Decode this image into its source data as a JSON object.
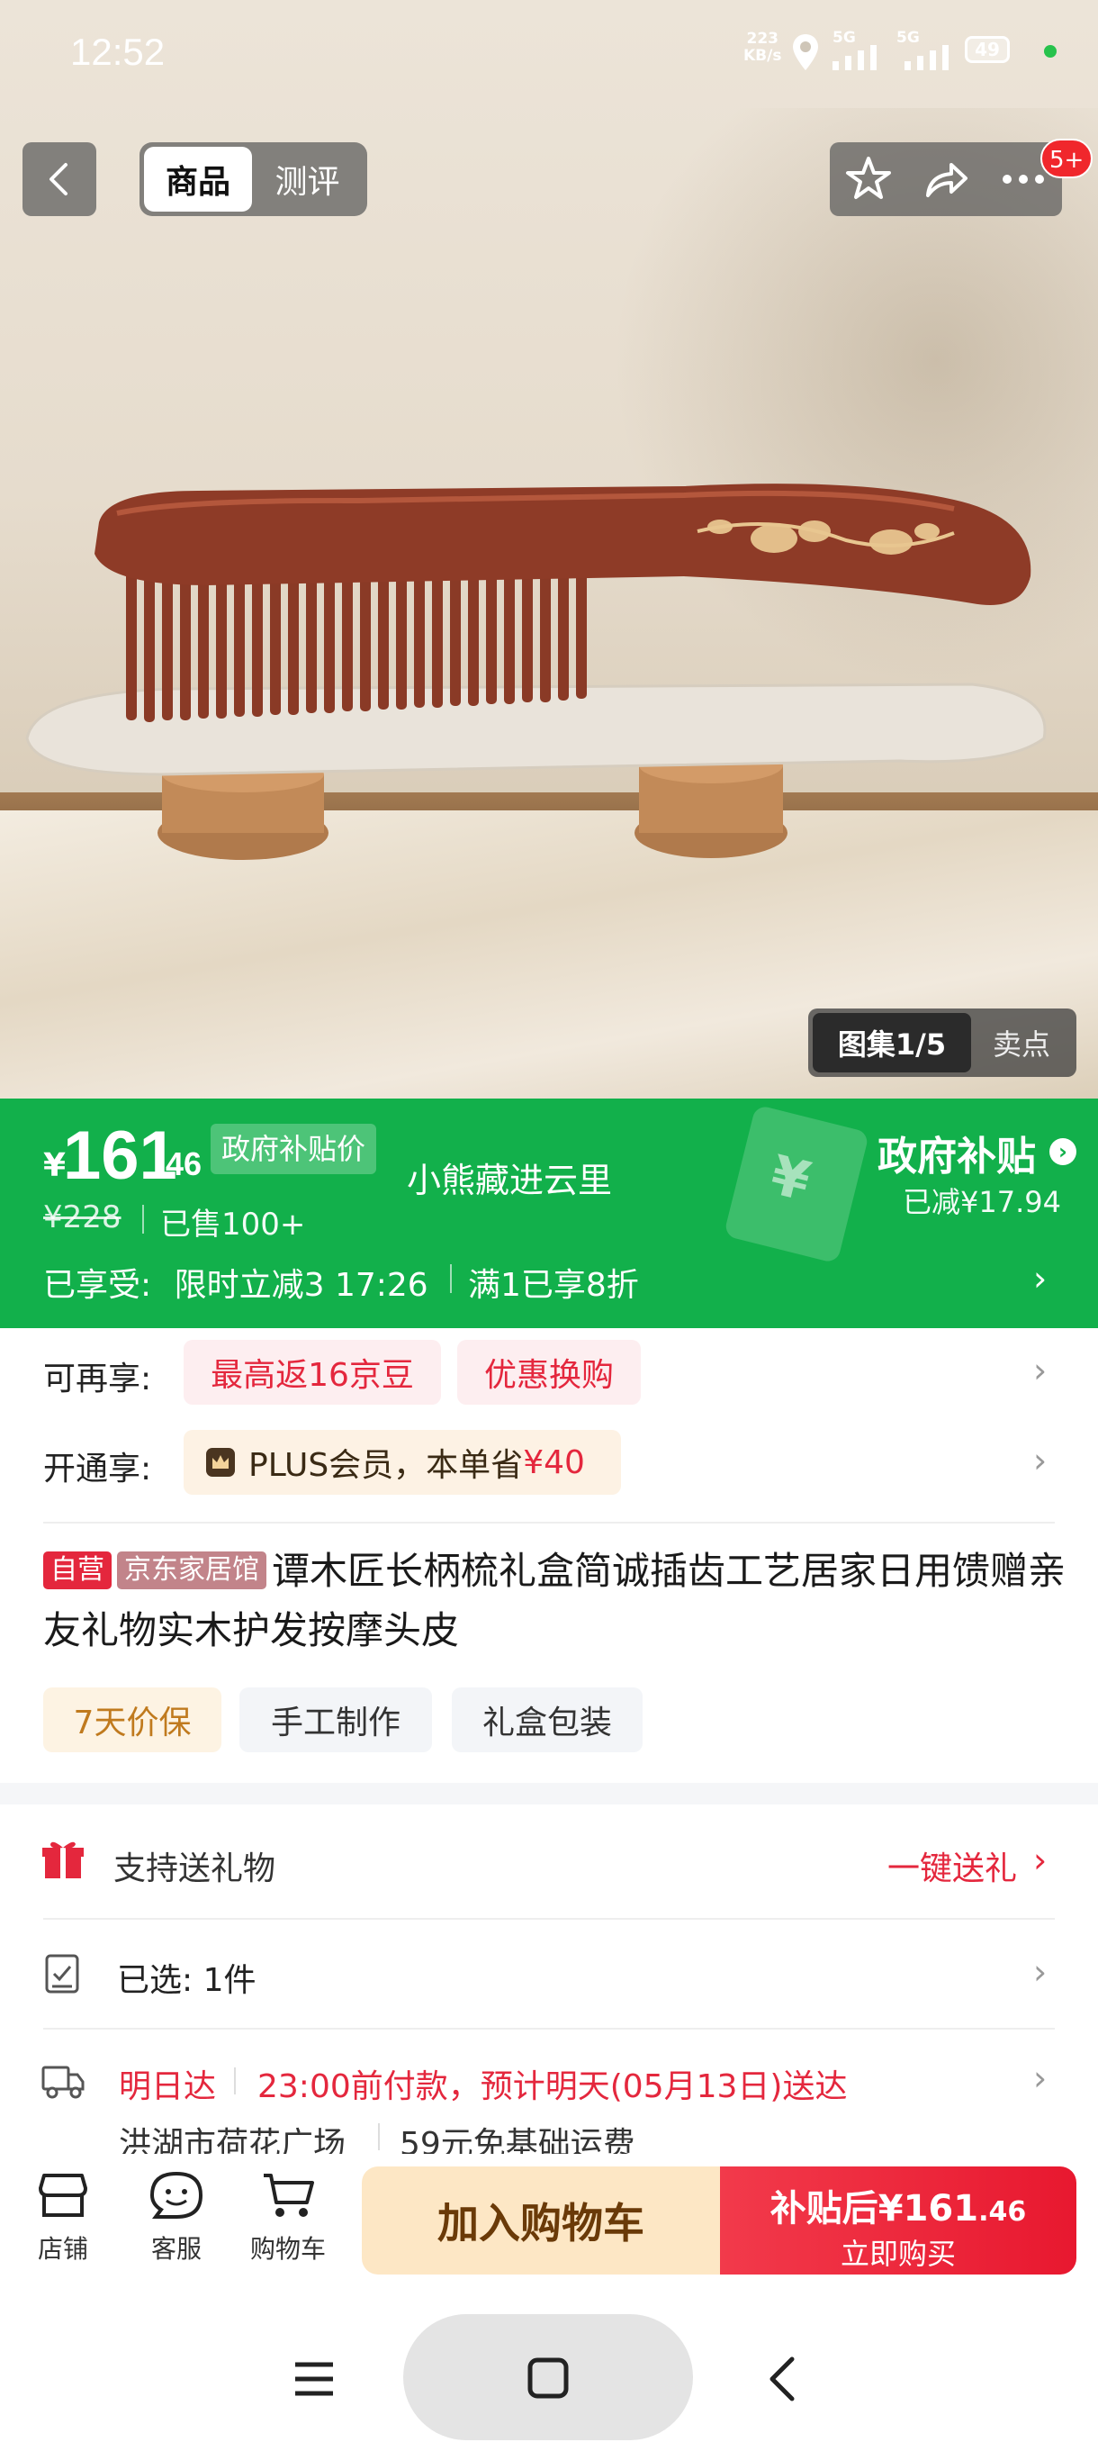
{
  "status_bar": {
    "time": "12:52",
    "net_speed_value": "223",
    "net_speed_unit": "KB/s",
    "signal_1": "5G",
    "signal_2": "5G",
    "battery": "49"
  },
  "header": {
    "tabs": [
      {
        "label": "商品",
        "active": true
      },
      {
        "label": "测评",
        "active": false
      }
    ],
    "message_badge": "5+"
  },
  "gallery": {
    "counter": "图集1/5",
    "selling_points": "卖点"
  },
  "price": {
    "currency": "¥",
    "integer": "161",
    "decimal": ".46",
    "subsidy_tag": "政府补贴价",
    "shop_name": "小熊藏进云里",
    "original_price": "¥228",
    "sold": "已售100+",
    "gov_subsidy_title": "政府补贴",
    "gov_subsidy_saved": "已减¥17.94",
    "enjoyed_label": "已享受:",
    "promo_1": "限时立减3 17:26",
    "promo_2": "满1已享8折"
  },
  "extras": {
    "label_1": "可再享:",
    "chip_jingdou": "最高返16京豆",
    "chip_swap": "优惠换购",
    "label_2": "开通享:",
    "plus_prefix": "PLUS会员，本单省",
    "plus_amount": "¥40"
  },
  "product": {
    "tag_self": "自营",
    "tag_store": "京东家居馆",
    "title": "谭木匠长柄梳礼盒简诚插齿工艺居家日用馈赠亲友礼物实木护发按摩头皮",
    "badges": [
      "7天价保",
      "手工制作",
      "礼盒包装"
    ]
  },
  "gift": {
    "label": "支持送礼物",
    "action": "一键送礼"
  },
  "selection": {
    "label": "已选: 1件"
  },
  "delivery": {
    "fast": "明日达",
    "detail": "23:00前付款，预计明天(05月13日)送达",
    "address": "洪湖市荷花广场",
    "shipping": "59元免基础运费"
  },
  "bottom_bar": {
    "store": "店铺",
    "service": "客服",
    "cart": "购物车",
    "add_to_cart": "加入购物车",
    "buy_price_prefix": "补贴后¥161",
    "buy_price_decimal": ".46",
    "buy_now": "立即购买"
  },
  "colors": {
    "subsidy_green": "#12b04b",
    "jd_red": "#e4273d",
    "cart_bg": "#fde7c5",
    "plus_gold": "#c07a1e"
  }
}
